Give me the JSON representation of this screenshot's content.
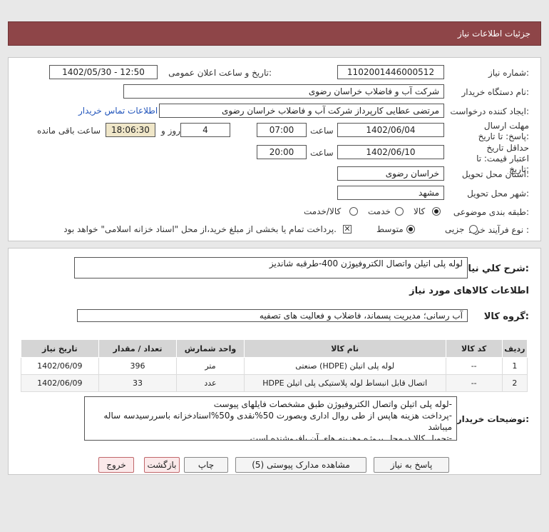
{
  "header": {
    "title": "جزئیات اطلاعات نیاز"
  },
  "form": {
    "need_number_label": "شماره نیاز:",
    "need_number": "1102001446000512",
    "announce_label": "تاریخ و ساعت اعلان عمومی:",
    "announce_value": "1402/05/30 - 12:50",
    "buyer_org_label": "نام دستگاه خریدار:",
    "buyer_org": "شرکت آب و فاضلاب خراسان رضوی",
    "creator_label": "ایجاد کننده درخواست:",
    "creator": "مرتضی عطایی کارپرداز شرکت آب و فاضلاب خراسان رضوی",
    "contact_link": "اطلاعات تماس خریدار",
    "reply_deadline_label": "مهلت ارسال پاسخ: تا تاریخ:",
    "reply_date": "1402/06/04",
    "time_label": "ساعت",
    "reply_time": "07:00",
    "days_value": "4",
    "days_label": "روز و",
    "remaining_time": "18:06:30",
    "remaining_label": "ساعت باقی مانده",
    "price_validity_label": "حداقل تاریخ اعتبار قیمت: تا تاریخ:",
    "price_date": "1402/06/10",
    "price_time": "20:00",
    "province_label": "استان محل تحویل:",
    "province": "خراسان رضوی",
    "city_label": "شهر محل تحویل:",
    "city": "مشهد",
    "category_label": "طبقه بندی موضوعی:",
    "category_options": [
      "کالا",
      "خدمت",
      "کالا/خدمت"
    ],
    "process_label": "نوع فرآیند خرید :",
    "process_options": [
      "جزیی",
      "متوسط"
    ],
    "payment_note": "پرداخت تمام یا بخشی از مبلغ خرید،از محل \"اسناد خزانه اسلامی\" خواهد بود."
  },
  "summary": {
    "title_label": "شرح کلي نياز:",
    "title_value": "لوله پلی اتیلن واتصال الکتروفیوژن 400-طرقبه شاندیز",
    "goods_info_title": "اطلاعات کالاهای مورد نیاز",
    "group_label": "گروه کالا:",
    "group_value": "آب رسانی؛ مدیریت پسماند، فاضلاب و فعالیت های تصفیه"
  },
  "table": {
    "headers": [
      "ردیف",
      "کد کالا",
      "نام کالا",
      "واحد شمارش",
      "تعداد / مقدار",
      "تاریخ نیاز"
    ],
    "rows": [
      [
        "1",
        "--",
        "لوله پلی اتیلن (HDPE) صنعتی",
        "متر",
        "396",
        "1402/06/09"
      ],
      [
        "2",
        "--",
        "اتصال قابل انبساط لوله پلاستیکی پلی اتیلن HDPE",
        "عدد",
        "33",
        "1402/06/09"
      ]
    ]
  },
  "buyer_notes": {
    "label": "توضیحات خریدار:",
    "text": "-لوله پلی اتیلن واتصال الکتروفیوژن طبق مشخصات فایلهای پیوست\n-پرداخت هزینه هاپس از طی روال اداری وبصورت 50%نقدی و50%اسنادخزانه باسررسیدسه ساله میباشد\n-تحویل کالا درمحل پروژه وهزینه های آن بافروشنده است"
  },
  "buttons": {
    "reply": "پاسخ به نیاز",
    "view_docs": "مشاهده مدارک پیوستی (5)",
    "print": "چاپ",
    "back": "بازگشت",
    "exit": "خروج"
  }
}
